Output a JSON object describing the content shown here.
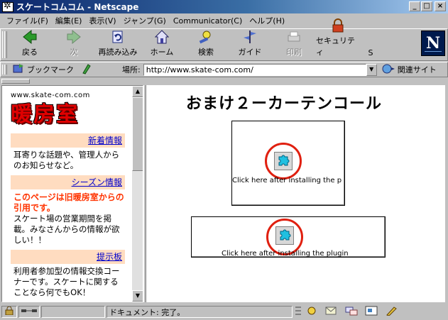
{
  "window": {
    "title": "スケートコムコム - Netscape"
  },
  "menu": [
    "ファイル(F)",
    "編集(E)",
    "表示(V)",
    "ジャンプ(G)",
    "Communicator(C)",
    "ヘルプ(H)"
  ],
  "toolbar": {
    "buttons": [
      {
        "label": "戻る",
        "icon": "back-arrow-icon",
        "enabled": true
      },
      {
        "label": "次",
        "icon": "forward-arrow-icon",
        "enabled": false
      },
      {
        "label": "再読み込み",
        "icon": "reload-icon",
        "enabled": true
      },
      {
        "label": "ホーム",
        "icon": "home-icon",
        "enabled": true
      },
      {
        "label": "検索",
        "icon": "search-icon",
        "enabled": true
      },
      {
        "label": "ガイド",
        "icon": "guide-icon",
        "enabled": true
      },
      {
        "label": "印刷",
        "icon": "print-icon",
        "enabled": false
      },
      {
        "label": "セキュリティ",
        "icon": "lock-icon",
        "enabled": true
      },
      {
        "label": "S",
        "icon": "stop-icon",
        "enabled": true
      }
    ]
  },
  "location": {
    "bookmark_label": "ブックマーク",
    "label": "場所:",
    "url": "http://www.skate-com.com/",
    "related_label": "関連サイト"
  },
  "left_frame": {
    "domain": "www.skate-com.com",
    "logo_text": "暖房室",
    "sections": [
      {
        "link": "新着情報",
        "text": "耳寄りな話題や、管理人からのお知らせなど。"
      },
      {
        "link": "シーズン情報",
        "highlight": "このページは旧暖房室からの引用です。",
        "text": "スケート場の営業期間を掲載。みなさんからの情報が欲しい！！"
      },
      {
        "link": "提示板",
        "text": "利用者参加型の情報交換コーナーです。スケートに関することなら何でもOK！"
      }
    ]
  },
  "right_frame": {
    "title": "おまけ２ーカーテンコール",
    "plugin1_text": "Click here after installing the p",
    "plugin2_text": "Click here after installing the plugin"
  },
  "status": {
    "message": "ドキュメント: 完了。"
  },
  "colors": {
    "accent_red": "#e00000",
    "nav_bg": "#ffdcc0",
    "title_bar": "#0a246a"
  }
}
